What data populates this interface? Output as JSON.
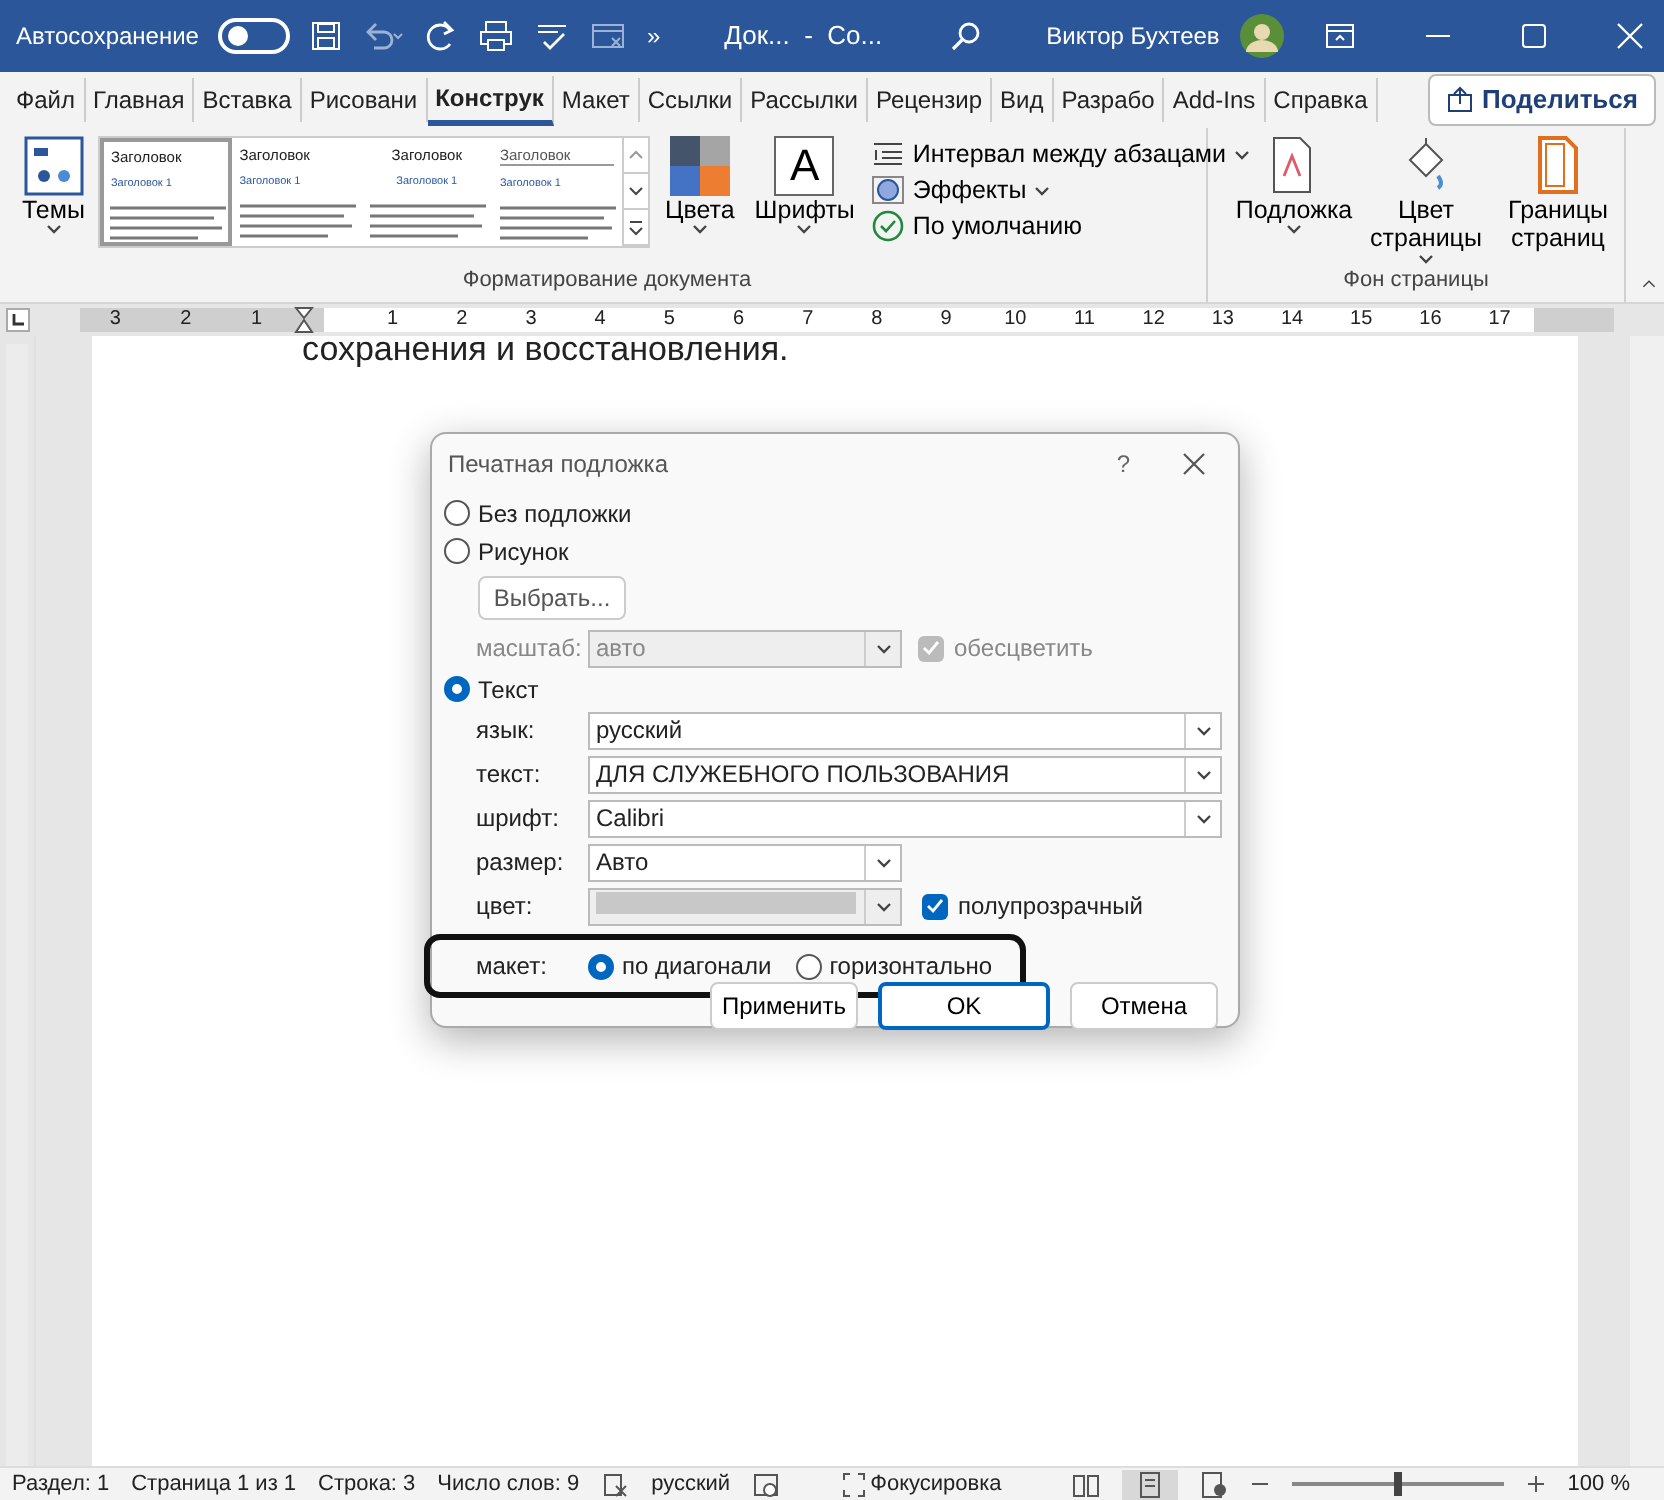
{
  "title_bar": {
    "autosave_label": "Автосохранение",
    "autosave_on": false,
    "more_glyph": "»",
    "document_title": "Док...  -  Со...",
    "user_name": "Виктор Бухтеев"
  },
  "ribbon_tabs": [
    {
      "label": "Файл",
      "selected": false
    },
    {
      "label": "Главная",
      "selected": false
    },
    {
      "label": "Вставка",
      "selected": false
    },
    {
      "label": "Рисовани",
      "selected": false
    },
    {
      "label": "Конструк",
      "selected": true
    },
    {
      "label": "Макет",
      "selected": false
    },
    {
      "label": "Ссылки",
      "selected": false
    },
    {
      "label": "Рассылки",
      "selected": false
    },
    {
      "label": "Рецензир",
      "selected": false
    },
    {
      "label": "Вид",
      "selected": false
    },
    {
      "label": "Разрабо",
      "selected": false
    },
    {
      "label": "Add-Ins",
      "selected": false
    },
    {
      "label": "Справка",
      "selected": false
    }
  ],
  "share_button": "Поделиться",
  "ribbon": {
    "themes": "Темы",
    "styles": [
      {
        "heading": "Заголовок",
        "subheading": "Заголовок 1",
        "kind": "left",
        "selected": true
      },
      {
        "heading": "Заголовок",
        "subheading": "Заголовок 1",
        "kind": "left",
        "selected": false
      },
      {
        "heading": "Заголовок",
        "subheading": "Заголовок 1",
        "kind": "center",
        "selected": false
      },
      {
        "heading": "Заголовок",
        "subheading": "Заголовок 1",
        "kind": "underline",
        "selected": false
      }
    ],
    "colors": "Цвета",
    "fonts": "Шрифты",
    "fonts_glyph": "A",
    "paragraph_spacing": "Интервал между абзацами",
    "effects": "Эффекты",
    "set_default": "По умолчанию",
    "group_document": "Форматирование документа",
    "watermark": "Подложка",
    "page_color": "Цвет страницы",
    "page_borders": "Границы страниц",
    "group_background": "Фон страницы"
  },
  "ruler": {
    "left_numbers": [
      "3",
      "2",
      "1"
    ],
    "right_numbers": [
      "1",
      "2",
      "3",
      "4",
      "5",
      "6",
      "7",
      "8",
      "9",
      "10",
      "11",
      "12",
      "13",
      "14",
      "15",
      "16",
      "17"
    ]
  },
  "document_text": "сохранения и восстановления.",
  "dialog": {
    "title": "Печатная подложка",
    "help": "?",
    "no_watermark": {
      "label": "Без подложки",
      "selected": false
    },
    "picture": {
      "label": "Рисунок",
      "selected": false,
      "select_button": "Выбрать...",
      "scale_label": "масштаб:",
      "scale_value": "авто",
      "washout_label": "обесцветить",
      "washout_checked": true
    },
    "text": {
      "label": "Текст",
      "selected": true,
      "fields": [
        {
          "label": "язык:",
          "value": "русский",
          "kind": "wide"
        },
        {
          "label": "текст:",
          "value": "ДЛЯ СЛУЖЕБНОГО ПОЛЬЗОВАНИЯ",
          "kind": "wide"
        },
        {
          "label": "шрифт:",
          "value": "Calibri",
          "kind": "wide"
        },
        {
          "label": "размер:",
          "value": "Авто",
          "kind": "short"
        }
      ],
      "color_label": "цвет:",
      "semitransparent_label": "полупрозрачный",
      "semitransparent_checked": true
    },
    "layout": {
      "label": "макет:",
      "highlighted": true,
      "options": [
        {
          "label": "по диагонали",
          "selected": true
        },
        {
          "label": "горизонтально",
          "selected": false
        }
      ]
    },
    "buttons": [
      {
        "label": "Применить",
        "default": false
      },
      {
        "label": "OK",
        "default": true
      },
      {
        "label": "Отмена",
        "default": false
      }
    ]
  },
  "status_bar": {
    "items": [
      "Раздел: 1",
      "Страница 1 из 1",
      "Строка: 3",
      "Число слов: 9"
    ],
    "language": "русский",
    "focus": "Фокусировка",
    "zoom_slider": {
      "level": 0.5
    },
    "zoom": "100 %"
  }
}
